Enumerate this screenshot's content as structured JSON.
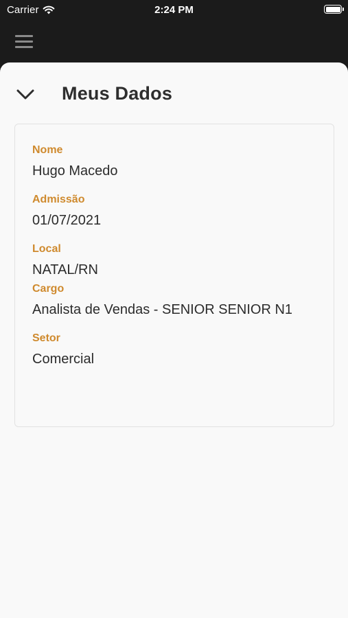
{
  "status_bar": {
    "carrier": "Carrier",
    "time": "2:24 PM",
    "icons": [
      "wifi-icon",
      "battery-icon"
    ]
  },
  "topbar": {
    "menu_icon": "hamburger-menu-icon"
  },
  "header": {
    "title": "Meus Dados",
    "back_icon": "chevron-down-icon"
  },
  "profile": {
    "fields": [
      {
        "label": "Nome",
        "value": "Hugo Macedo"
      },
      {
        "label": "Admissão",
        "value": "01/07/2021"
      },
      {
        "label": "Local",
        "value": "NATAL/RN"
      },
      {
        "label": "Cargo",
        "value": "Analista de Vendas - SENIOR SENIOR N1"
      },
      {
        "label": "Setor",
        "value": "Comercial"
      }
    ]
  },
  "colors": {
    "background_dark": "#1b1b1b",
    "sheet": "#f9f9f9",
    "label_accent": "#cf8a2e",
    "text": "#2c2c2c"
  }
}
